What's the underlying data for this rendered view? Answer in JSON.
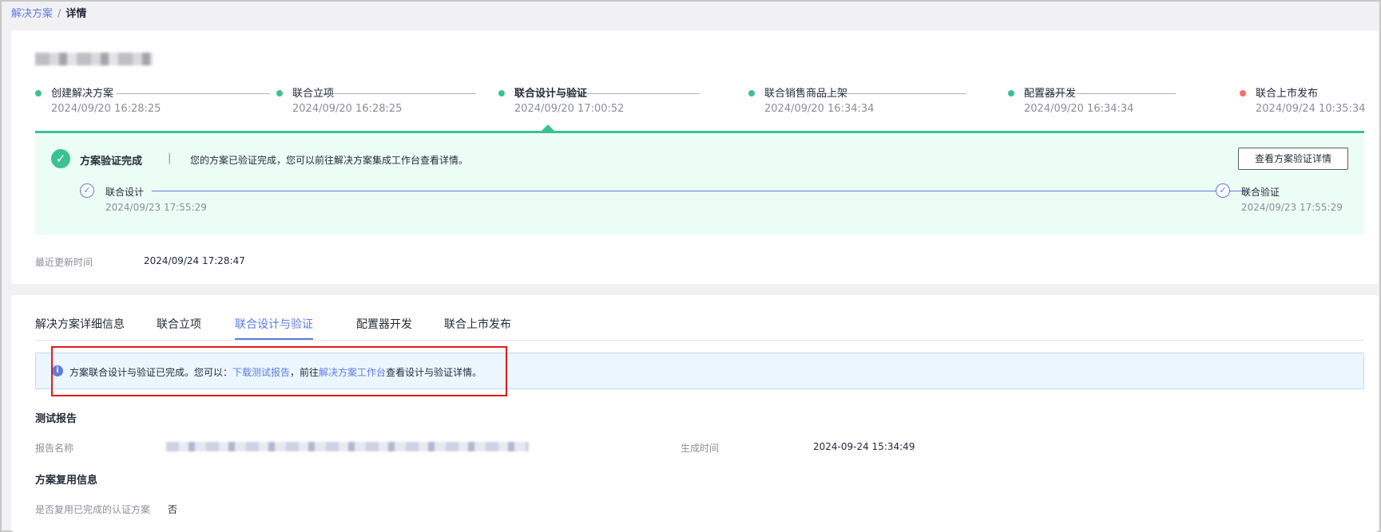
{
  "breadcrumb": {
    "parent": "解决方案",
    "separator": "/",
    "current": "详情"
  },
  "steps": [
    {
      "label": "创建解决方案",
      "time": "2024/09/20 16:28:25",
      "status": "done"
    },
    {
      "label": "联合立项",
      "time": "2024/09/20 16:28:25",
      "status": "done"
    },
    {
      "label": "联合设计与验证",
      "time": "2024/09/20 17:00:52",
      "status": "current"
    },
    {
      "label": "联合销售商品上架",
      "time": "2024/09/20 16:34:34",
      "status": "done"
    },
    {
      "label": "配置器开发",
      "time": "2024/09/20 16:34:34",
      "status": "done"
    },
    {
      "label": "联合上市发布",
      "time": "2024/09/24 10:35:34",
      "status": "error"
    }
  ],
  "verify": {
    "title": "方案验证完成",
    "divider": "|",
    "desc": "您的方案已验证完成，您可以前往解决方案集成工作台查看详情。",
    "button": "查看方案验证详情",
    "sub_steps": [
      {
        "label": "联合设计",
        "time": "2024/09/23 17:55:29"
      },
      {
        "label": "联合验证",
        "time": "2024/09/23 17:55:29"
      }
    ]
  },
  "last_update": {
    "label": "最近更新时间",
    "value": "2024/09/24 17:28:47"
  },
  "tabs": [
    {
      "label": "解决方案详细信息"
    },
    {
      "label": "联合立项"
    },
    {
      "label": "联合设计与验证"
    },
    {
      "label": "配置器开发"
    },
    {
      "label": "联合上市发布"
    }
  ],
  "active_tab": "联合设计与验证",
  "info": {
    "prefix": "方案联合设计与验证已完成。您可以：",
    "link1": "下载测试报告",
    "middle": "，前往",
    "link2": "解决方案工作台",
    "suffix": "查看设计与验证详情。"
  },
  "report": {
    "section_title": "测试报告",
    "name_label": "报告名称",
    "time_label": "生成时间",
    "time_value": "2024-09-24 15:34:49"
  },
  "reuse": {
    "section_title": "方案复用信息",
    "label": "是否复用已完成的认证方案",
    "value": "否"
  },
  "colors": {
    "accent": "#5e7ce0",
    "success": "#3ac295",
    "error": "#f66f6a",
    "highlight": "#e31a1c"
  }
}
